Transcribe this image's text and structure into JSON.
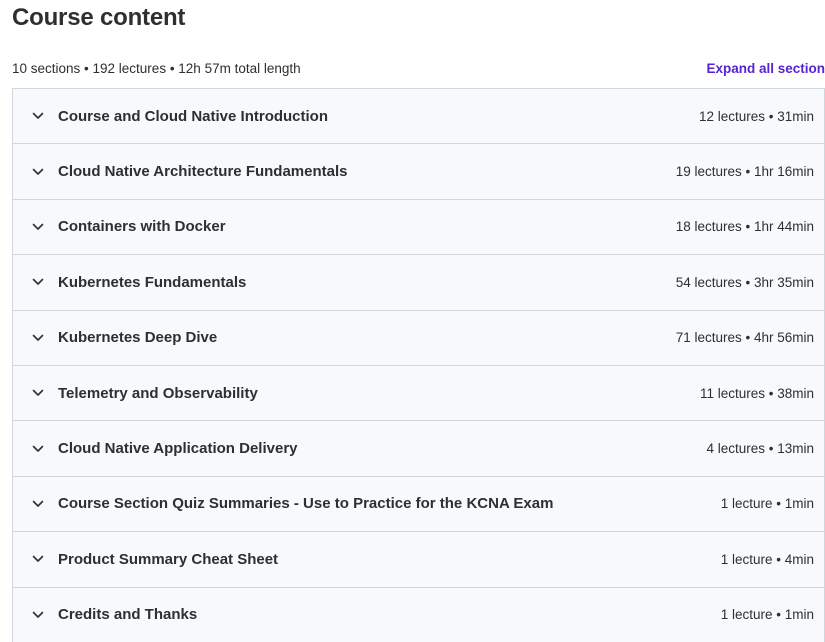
{
  "header": {
    "title": "Course content",
    "summary": "10 sections • 192 lectures • 12h 57m total length",
    "expand_all_label": "Expand all section"
  },
  "sections": [
    {
      "title": "Course and Cloud Native Introduction",
      "meta": "12 lectures • 31min"
    },
    {
      "title": "Cloud Native Architecture Fundamentals",
      "meta": "19 lectures • 1hr 16min"
    },
    {
      "title": "Containers with Docker",
      "meta": "18 lectures • 1hr 44min"
    },
    {
      "title": "Kubernetes Fundamentals",
      "meta": "54 lectures • 3hr 35min"
    },
    {
      "title": "Kubernetes Deep Dive",
      "meta": "71 lectures • 4hr 56min"
    },
    {
      "title": "Telemetry and Observability",
      "meta": "11 lectures • 38min"
    },
    {
      "title": "Cloud Native Application Delivery",
      "meta": "4 lectures • 13min"
    },
    {
      "title": "Course Section Quiz Summaries - Use to Practice for the KCNA Exam",
      "meta": "1 lecture • 1min"
    },
    {
      "title": "Product Summary Cheat Sheet",
      "meta": "1 lecture • 4min"
    },
    {
      "title": "Credits and Thanks",
      "meta": "1 lecture • 1min"
    }
  ],
  "icons": {
    "section_toggle": "chevron-down-icon"
  },
  "colors": {
    "accent": "#5624d0",
    "text": "#2d2f31",
    "row_bg": "#f7f9fa",
    "border": "#d1d7dc"
  }
}
